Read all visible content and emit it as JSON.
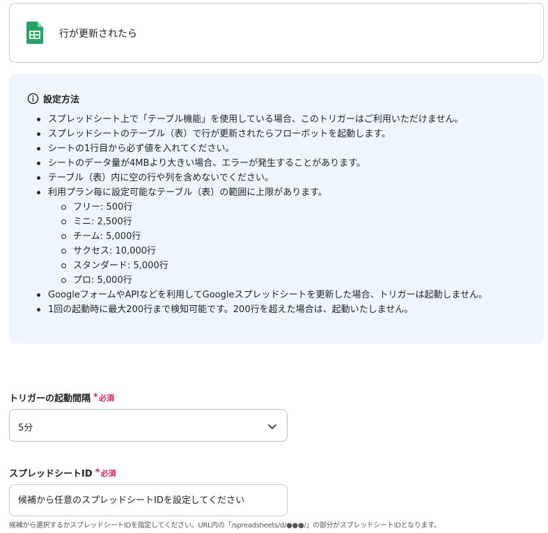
{
  "trigger": {
    "icon": "google-sheets-icon",
    "title": "行が更新されたら"
  },
  "info": {
    "icon": "info-circle-icon",
    "title": "設定方法",
    "items": [
      {
        "text": "スプレッドシート上で「テーブル機能」を使用している場合、このトリガーはご利用いただけません。",
        "level": 1
      },
      {
        "text": "スプレッドシートのテーブル（表）で行が更新されたらフローボットを起動します。",
        "level": 1
      },
      {
        "text": "シートの1行目から必ず値を入れてください。",
        "level": 1
      },
      {
        "text": "シートのデータ量が4MBより大きい場合、エラーが発生することがあります。",
        "level": 1
      },
      {
        "text": "テーブル（表）内に空の行や列を含めないでください。",
        "level": 1
      },
      {
        "text": "利用プラン毎に設定可能なテーブル（表）の範囲に上限があります。",
        "level": 1
      },
      {
        "text": "フリー: 500行",
        "level": 2
      },
      {
        "text": "ミニ: 2,500行",
        "level": 2
      },
      {
        "text": "チーム: 5,000行",
        "level": 2
      },
      {
        "text": "サクセス: 10,000行",
        "level": 2
      },
      {
        "text": "スタンダード: 5,000行",
        "level": 2
      },
      {
        "text": "プロ: 5,000行",
        "level": 2
      },
      {
        "text": "GoogleフォームやAPIなどを利用してGoogleスプレッドシートを更新した場合、トリガーは起動しません。",
        "level": 1
      },
      {
        "text": "1回の起動時に最大200行まで検知可能です。200行を超えた場合は、起動いたしません。",
        "level": 1
      }
    ]
  },
  "interval": {
    "label": "トリガーの起動間隔",
    "required_mark": "*",
    "required_text": "必須",
    "value": "5分"
  },
  "spreadsheet": {
    "label": "スプレッドシートID",
    "required_mark": "*",
    "required_text": "必須",
    "placeholder": "候補から任意のスプレッドシートIDを設定してください",
    "help": "候補から選択するかスプレッドシートIDを指定してください。URL内の「/spreadsheets/d/●●●/」の部分がスプレッドシートIDとなります。"
  },
  "colors": {
    "sheets_green": "#23a566",
    "info_bg": "#eef5fd",
    "required": "#e0245e"
  }
}
